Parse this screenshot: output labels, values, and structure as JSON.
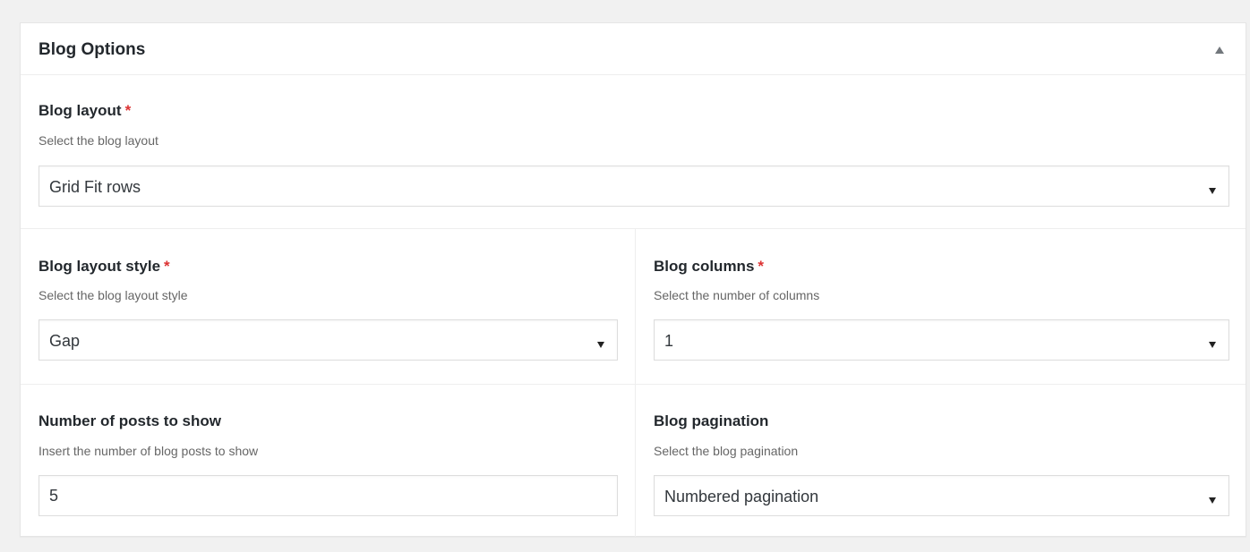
{
  "box": {
    "title": "Blog Options",
    "toggle_icon": "triangle-up-icon"
  },
  "fields": {
    "blog_layout": {
      "label": "Blog layout",
      "required": "*",
      "description": "Select the blog layout",
      "value": "Grid Fit rows"
    },
    "blog_layout_style": {
      "label": "Blog layout style",
      "required": "*",
      "description": "Select the blog layout style",
      "value": "Gap"
    },
    "blog_columns": {
      "label": "Blog columns",
      "required": "*",
      "description": "Select the number of columns",
      "value": "1"
    },
    "posts_to_show": {
      "label": "Number of posts to show",
      "description": "Insert the number of blog posts to show",
      "value": "5"
    },
    "blog_pagination": {
      "label": "Blog pagination",
      "description": "Select the blog pagination",
      "value": "Numbered pagination"
    }
  },
  "colors": {
    "required": "#dc3232",
    "background": "#f1f1f1",
    "panel": "#ffffff",
    "border": "#dddddd"
  }
}
